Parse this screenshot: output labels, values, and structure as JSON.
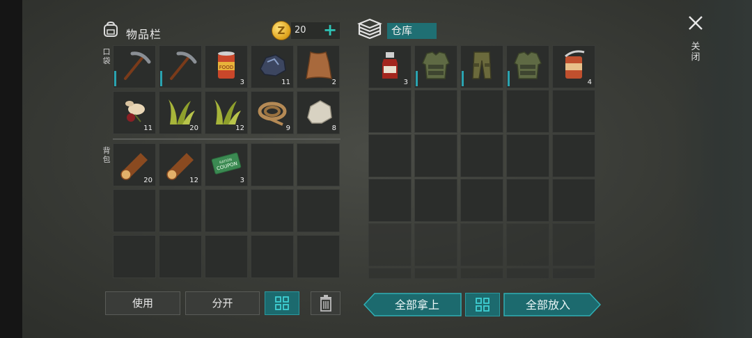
{
  "inventory": {
    "title": "物品栏",
    "icon": "backpack-icon",
    "coins": "20",
    "add_icon": "plus-icon",
    "pocket_label": "口袋",
    "bag_label": "背包",
    "pocket_slots": [
      {
        "icon": "pickaxe-icon",
        "count": "",
        "durability": true
      },
      {
        "icon": "pickaxe-icon",
        "count": "",
        "durability": true
      },
      {
        "icon": "canned-food-icon",
        "count": "3"
      },
      {
        "icon": "ore-icon",
        "count": "11"
      },
      {
        "icon": "leather-icon",
        "count": "2"
      },
      {
        "icon": "berries-icon",
        "count": "11"
      },
      {
        "icon": "plant-fiber-icon",
        "count": "20"
      },
      {
        "icon": "plant-fiber-icon",
        "count": "12"
      },
      {
        "icon": "rope-icon",
        "count": "9"
      },
      {
        "icon": "stone-icon",
        "count": "8"
      }
    ],
    "bag_slots": [
      {
        "icon": "log-icon",
        "count": "20"
      },
      {
        "icon": "log-icon",
        "count": "12"
      },
      {
        "icon": "coupon-icon",
        "count": "3",
        "text_top": "RATION",
        "text_bottom": "COUPON"
      },
      {
        "icon": "",
        "count": ""
      },
      {
        "icon": "",
        "count": ""
      },
      {
        "icon": "",
        "count": ""
      },
      {
        "icon": "",
        "count": ""
      },
      {
        "icon": "",
        "count": ""
      },
      {
        "icon": "",
        "count": ""
      },
      {
        "icon": "",
        "count": ""
      },
      {
        "icon": "",
        "count": ""
      },
      {
        "icon": "",
        "count": ""
      },
      {
        "icon": "",
        "count": ""
      },
      {
        "icon": "",
        "count": ""
      },
      {
        "icon": "",
        "count": ""
      }
    ],
    "buttons": {
      "use": "使用",
      "split": "分开",
      "sort_icon": "grid-icon",
      "trash_icon": "trash-icon"
    }
  },
  "storage": {
    "title": "仓库",
    "icon": "crate-icon",
    "slots": [
      {
        "icon": "bottle-icon",
        "count": "3"
      },
      {
        "icon": "armor-vest-icon",
        "count": "",
        "durability": true
      },
      {
        "icon": "armor-pants-icon",
        "count": "",
        "durability": true
      },
      {
        "icon": "armor-vest-icon",
        "count": "",
        "durability": true
      },
      {
        "icon": "open-can-icon",
        "count": "4"
      }
    ],
    "buttons": {
      "take_all": "全部拿上",
      "sort_icon": "grid-icon",
      "put_all": "全部放入"
    }
  },
  "close": {
    "label": "关闭",
    "icon": "close-icon"
  },
  "colors": {
    "accent": "#2aa3b0",
    "teal_button": "#1c6a6e",
    "slot": "#2b2d2b"
  }
}
